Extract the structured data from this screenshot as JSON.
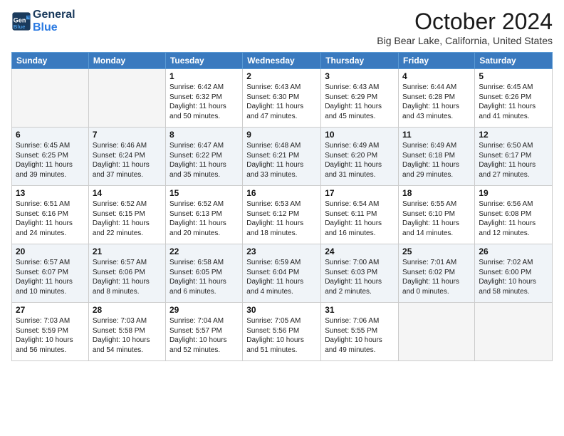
{
  "header": {
    "logo_line1": "General",
    "logo_line2": "Blue",
    "month": "October 2024",
    "location": "Big Bear Lake, California, United States"
  },
  "weekdays": [
    "Sunday",
    "Monday",
    "Tuesday",
    "Wednesday",
    "Thursday",
    "Friday",
    "Saturday"
  ],
  "weeks": [
    [
      {
        "day": "",
        "info": ""
      },
      {
        "day": "",
        "info": ""
      },
      {
        "day": "1",
        "info": "Sunrise: 6:42 AM\nSunset: 6:32 PM\nDaylight: 11 hours and 50 minutes."
      },
      {
        "day": "2",
        "info": "Sunrise: 6:43 AM\nSunset: 6:30 PM\nDaylight: 11 hours and 47 minutes."
      },
      {
        "day": "3",
        "info": "Sunrise: 6:43 AM\nSunset: 6:29 PM\nDaylight: 11 hours and 45 minutes."
      },
      {
        "day": "4",
        "info": "Sunrise: 6:44 AM\nSunset: 6:28 PM\nDaylight: 11 hours and 43 minutes."
      },
      {
        "day": "5",
        "info": "Sunrise: 6:45 AM\nSunset: 6:26 PM\nDaylight: 11 hours and 41 minutes."
      }
    ],
    [
      {
        "day": "6",
        "info": "Sunrise: 6:45 AM\nSunset: 6:25 PM\nDaylight: 11 hours and 39 minutes."
      },
      {
        "day": "7",
        "info": "Sunrise: 6:46 AM\nSunset: 6:24 PM\nDaylight: 11 hours and 37 minutes."
      },
      {
        "day": "8",
        "info": "Sunrise: 6:47 AM\nSunset: 6:22 PM\nDaylight: 11 hours and 35 minutes."
      },
      {
        "day": "9",
        "info": "Sunrise: 6:48 AM\nSunset: 6:21 PM\nDaylight: 11 hours and 33 minutes."
      },
      {
        "day": "10",
        "info": "Sunrise: 6:49 AM\nSunset: 6:20 PM\nDaylight: 11 hours and 31 minutes."
      },
      {
        "day": "11",
        "info": "Sunrise: 6:49 AM\nSunset: 6:18 PM\nDaylight: 11 hours and 29 minutes."
      },
      {
        "day": "12",
        "info": "Sunrise: 6:50 AM\nSunset: 6:17 PM\nDaylight: 11 hours and 27 minutes."
      }
    ],
    [
      {
        "day": "13",
        "info": "Sunrise: 6:51 AM\nSunset: 6:16 PM\nDaylight: 11 hours and 24 minutes."
      },
      {
        "day": "14",
        "info": "Sunrise: 6:52 AM\nSunset: 6:15 PM\nDaylight: 11 hours and 22 minutes."
      },
      {
        "day": "15",
        "info": "Sunrise: 6:52 AM\nSunset: 6:13 PM\nDaylight: 11 hours and 20 minutes."
      },
      {
        "day": "16",
        "info": "Sunrise: 6:53 AM\nSunset: 6:12 PM\nDaylight: 11 hours and 18 minutes."
      },
      {
        "day": "17",
        "info": "Sunrise: 6:54 AM\nSunset: 6:11 PM\nDaylight: 11 hours and 16 minutes."
      },
      {
        "day": "18",
        "info": "Sunrise: 6:55 AM\nSunset: 6:10 PM\nDaylight: 11 hours and 14 minutes."
      },
      {
        "day": "19",
        "info": "Sunrise: 6:56 AM\nSunset: 6:08 PM\nDaylight: 11 hours and 12 minutes."
      }
    ],
    [
      {
        "day": "20",
        "info": "Sunrise: 6:57 AM\nSunset: 6:07 PM\nDaylight: 11 hours and 10 minutes."
      },
      {
        "day": "21",
        "info": "Sunrise: 6:57 AM\nSunset: 6:06 PM\nDaylight: 11 hours and 8 minutes."
      },
      {
        "day": "22",
        "info": "Sunrise: 6:58 AM\nSunset: 6:05 PM\nDaylight: 11 hours and 6 minutes."
      },
      {
        "day": "23",
        "info": "Sunrise: 6:59 AM\nSunset: 6:04 PM\nDaylight: 11 hours and 4 minutes."
      },
      {
        "day": "24",
        "info": "Sunrise: 7:00 AM\nSunset: 6:03 PM\nDaylight: 11 hours and 2 minutes."
      },
      {
        "day": "25",
        "info": "Sunrise: 7:01 AM\nSunset: 6:02 PM\nDaylight: 11 hours and 0 minutes."
      },
      {
        "day": "26",
        "info": "Sunrise: 7:02 AM\nSunset: 6:00 PM\nDaylight: 10 hours and 58 minutes."
      }
    ],
    [
      {
        "day": "27",
        "info": "Sunrise: 7:03 AM\nSunset: 5:59 PM\nDaylight: 10 hours and 56 minutes."
      },
      {
        "day": "28",
        "info": "Sunrise: 7:03 AM\nSunset: 5:58 PM\nDaylight: 10 hours and 54 minutes."
      },
      {
        "day": "29",
        "info": "Sunrise: 7:04 AM\nSunset: 5:57 PM\nDaylight: 10 hours and 52 minutes."
      },
      {
        "day": "30",
        "info": "Sunrise: 7:05 AM\nSunset: 5:56 PM\nDaylight: 10 hours and 51 minutes."
      },
      {
        "day": "31",
        "info": "Sunrise: 7:06 AM\nSunset: 5:55 PM\nDaylight: 10 hours and 49 minutes."
      },
      {
        "day": "",
        "info": ""
      },
      {
        "day": "",
        "info": ""
      }
    ]
  ]
}
